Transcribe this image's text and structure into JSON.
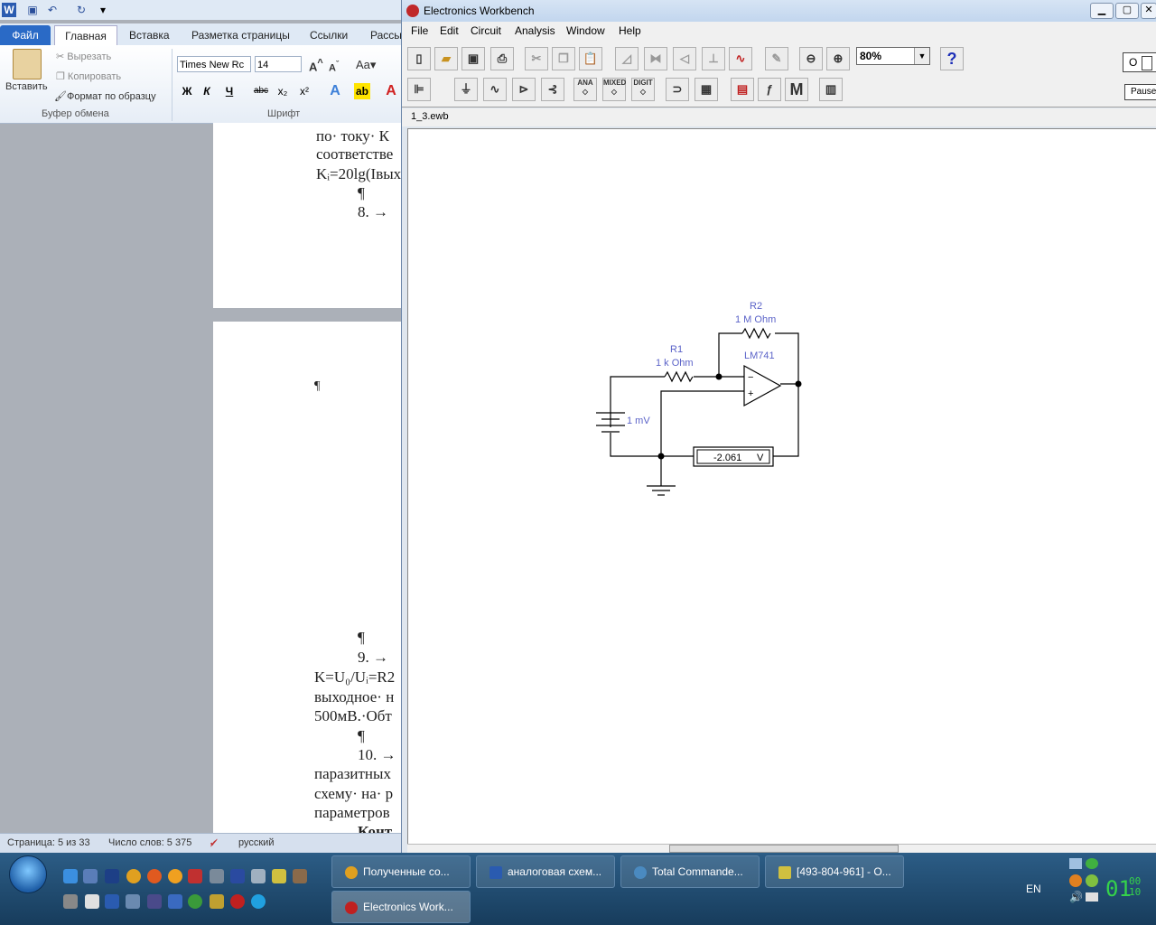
{
  "word": {
    "tabs": [
      "Файл",
      "Главная",
      "Вставка",
      "Разметка страницы",
      "Ссылки",
      "Рассы"
    ],
    "clipboard": {
      "paste": "Вставить",
      "cut": "Вырезать",
      "copy": "Копировать",
      "format_painter": "Формат по образцу",
      "group": "Буфер обмена"
    },
    "font": {
      "name": "Times New Rc",
      "size": "14",
      "group": "Шрифт",
      "buttons": [
        "Ж",
        "К",
        "Ч",
        "abc",
        "x₂",
        "x²"
      ]
    },
    "doc_lines_page1": [
      "по· току· К",
      "соответстве",
      "Kᵢ=20lg(Iвых",
      "¶",
      "8. →"
    ],
    "doc_lines_page2": [
      "¶",
      "¶",
      "9. →",
      "K=U₀/Uᵢ=R2",
      "выходное· н",
      "500мВ.·Обт",
      "¶",
      "10. →",
      "паразитных",
      "схему· на· р",
      "параметров",
      "Конт"
    ],
    "status": {
      "page": "Страница: 5 из 33",
      "words": "Число слов: 5 375",
      "lang": "русский"
    }
  },
  "ewb": {
    "title": "Electronics Workbench",
    "menu": [
      "File",
      "Edit",
      "Circuit",
      "Analysis",
      "Window",
      "Help"
    ],
    "zoom": "80%",
    "help": "?",
    "onoff": "O",
    "pause": "Pause",
    "doc_tab": "1_3.ewb",
    "parts_labels": {
      "ana": "ANA",
      "mixed": "MIXED",
      "digit": "DIGIT",
      "m": "M"
    },
    "circuit": {
      "r1_name": "R1",
      "r1_value": "1 k Ohm",
      "r2_name": "R2",
      "r2_value": "1 M Ohm",
      "opamp": "LM741",
      "opamp_minus": "−",
      "opamp_plus": "+",
      "source": "1 mV",
      "meter_value": "-2.061",
      "meter_unit": "V"
    }
  },
  "taskbar": {
    "tasks": [
      "Полученные со...",
      "аналоговая схем...",
      "Total Commande...",
      "[493-804-961] - О...",
      "Electronics Work..."
    ],
    "lang": "EN",
    "clock": "01",
    "clock_small_top": "00",
    "clock_small_bottom": "10"
  },
  "colors": {
    "component_label": "#5b63c8",
    "win_blue": "#2a6ac6",
    "clock": "#35d24a"
  }
}
